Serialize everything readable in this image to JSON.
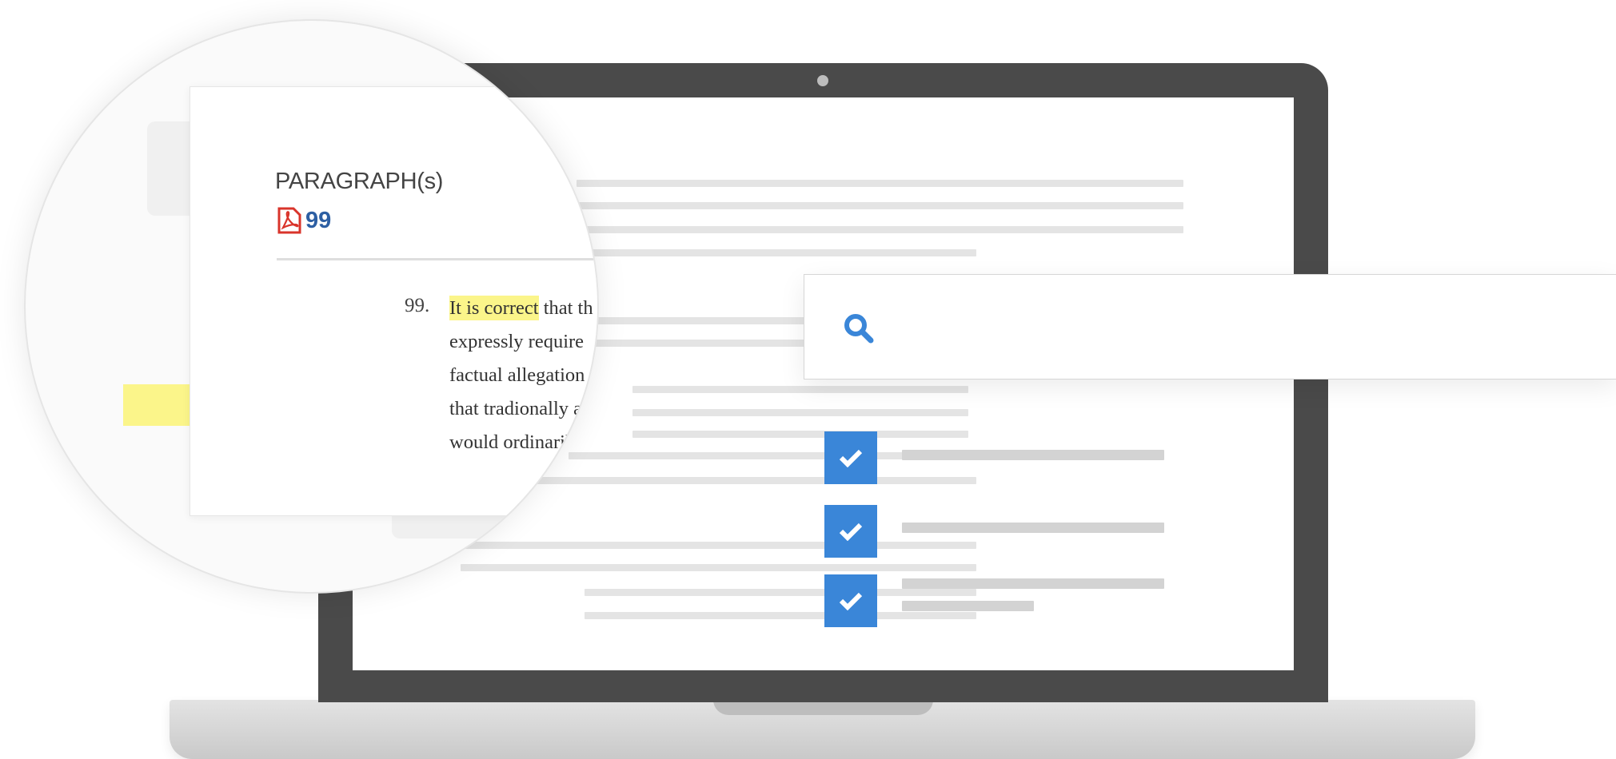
{
  "paragraph_panel": {
    "heading": "PARAGRAPH(s)",
    "pdf_link_number": "99",
    "paragraph_number": "99.",
    "highlighted_text": "It is correct",
    "lines": [
      " that th",
      "expressly require",
      "factual allegation",
      "that tradionally a",
      "would ordinarily"
    ]
  },
  "icons": {
    "pdf": "pdf-file-icon",
    "search": "search-icon",
    "check": "check-icon",
    "camera": "camera-icon"
  },
  "colors": {
    "accent_blue": "#3a86d8",
    "highlight_yellow": "#fbf58a",
    "pdf_red": "#d9342b",
    "laptop_dark": "#4a4a4a"
  }
}
